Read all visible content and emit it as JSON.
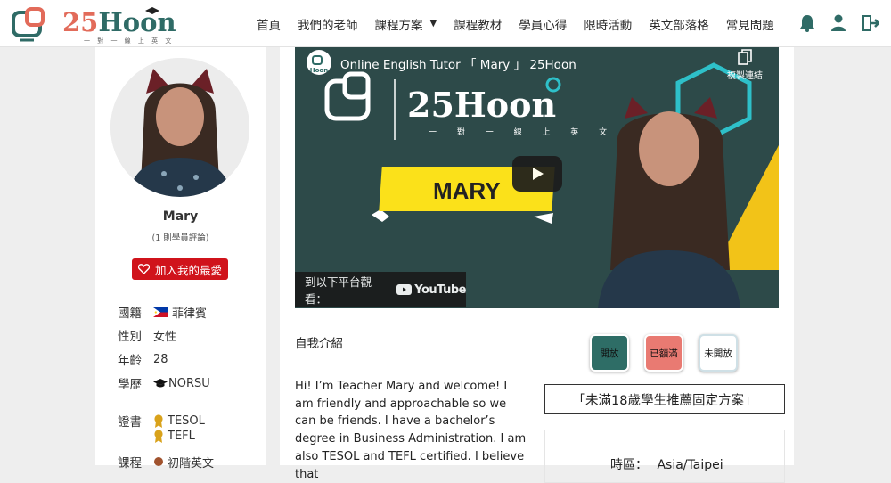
{
  "brand": {
    "logo_number": "25",
    "logo_word": "Hoon",
    "logo_tagline": "一 對 一 線 上 英 文"
  },
  "nav": {
    "items": [
      {
        "label": "首頁"
      },
      {
        "label": "我們的老師"
      },
      {
        "label": "課程方案",
        "has_dropdown": true
      },
      {
        "label": "課程教材"
      },
      {
        "label": "學員心得"
      },
      {
        "label": "限時活動"
      },
      {
        "label": "英文部落格"
      },
      {
        "label": "常見問題"
      }
    ],
    "icons": [
      "bell-icon",
      "user-icon",
      "logout-icon"
    ]
  },
  "tutor": {
    "name": "Mary",
    "review_count": "(1 則學員評論)",
    "favorite_label": "加入我的最愛",
    "nationality_label": "國籍",
    "nationality": "菲律賓",
    "gender_label": "性別",
    "gender": "女性",
    "age_label": "年齡",
    "age": "28",
    "education_label": "學歷",
    "education": "NORSU",
    "cert_label": "證書",
    "certificates": [
      "TESOL",
      "TEFL"
    ],
    "course_label": "課程",
    "course": "初階英文"
  },
  "video": {
    "title": "Online English Tutor 「 Mary 」 25Hoon",
    "copy_link_label": "複製連結",
    "logo_text": "25Hoon",
    "logo_sub": "一 對 一 線 上 英 文",
    "banner_text": "MARY",
    "watch_on_label": "到以下平台觀看：",
    "platform": "YouTube"
  },
  "intro": {
    "heading": "自我介紹",
    "body": "Hi! I’m Teacher Mary and welcome! I am friendly and approachable so we can be friends. I have a bachelor’s degree in Business Administration. I am also TESOL and TEFL certified. I believe that"
  },
  "schedule": {
    "legend": [
      {
        "label": "開放",
        "color": "#2e6d66"
      },
      {
        "label": "已額滿",
        "color": "#e97a72"
      },
      {
        "label": "未開放",
        "color": "#ffffff"
      }
    ],
    "promo_text": "「未滿18歲學生推薦固定方案」",
    "timezone_label": "時區：",
    "timezone": "Asia/Taipei"
  },
  "colors": {
    "brand_teal": "#2f6b66",
    "brand_coral": "#e26b5a",
    "favorite_red": "#d0131b",
    "video_bg": "#2d4a49",
    "banner_yellow": "#fbe11a"
  }
}
